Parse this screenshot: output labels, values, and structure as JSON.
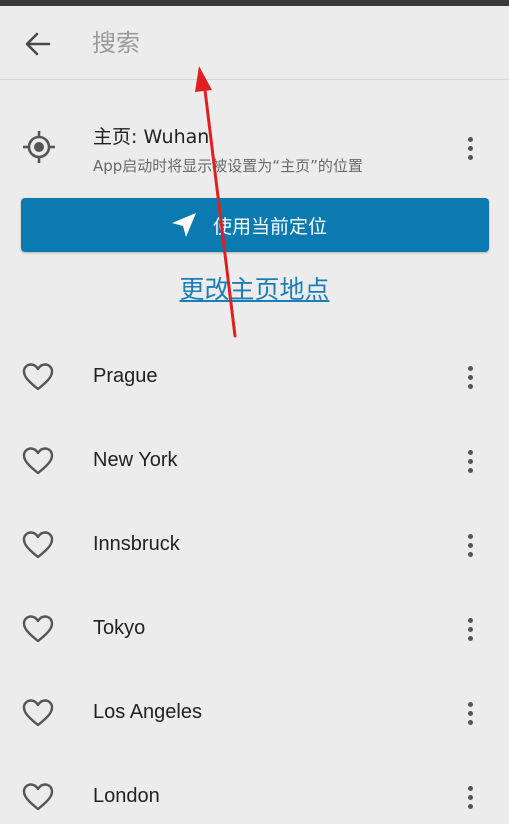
{
  "search": {
    "placeholder": "搜索"
  },
  "home": {
    "title": "主页: Wuhan",
    "subtitle": "App启动时将显示被设置为“主页”的位置",
    "icon": "my-location-icon"
  },
  "locate_button": {
    "label": "使用当前定位",
    "icon": "navigation-arrow-icon",
    "color": "#0a7ab0"
  },
  "change_home": {
    "label": "更改主页地点",
    "color": "#1a7fb8"
  },
  "cities": [
    {
      "name": "Prague"
    },
    {
      "name": "New York"
    },
    {
      "name": "Innsbruck"
    },
    {
      "name": "Tokyo"
    },
    {
      "name": "Los Angeles"
    },
    {
      "name": "London"
    }
  ],
  "icons": {
    "back": "arrow-left-icon",
    "favorite": "heart-outline-icon",
    "more": "more-vertical-icon"
  },
  "annotation_color": "#e02020"
}
